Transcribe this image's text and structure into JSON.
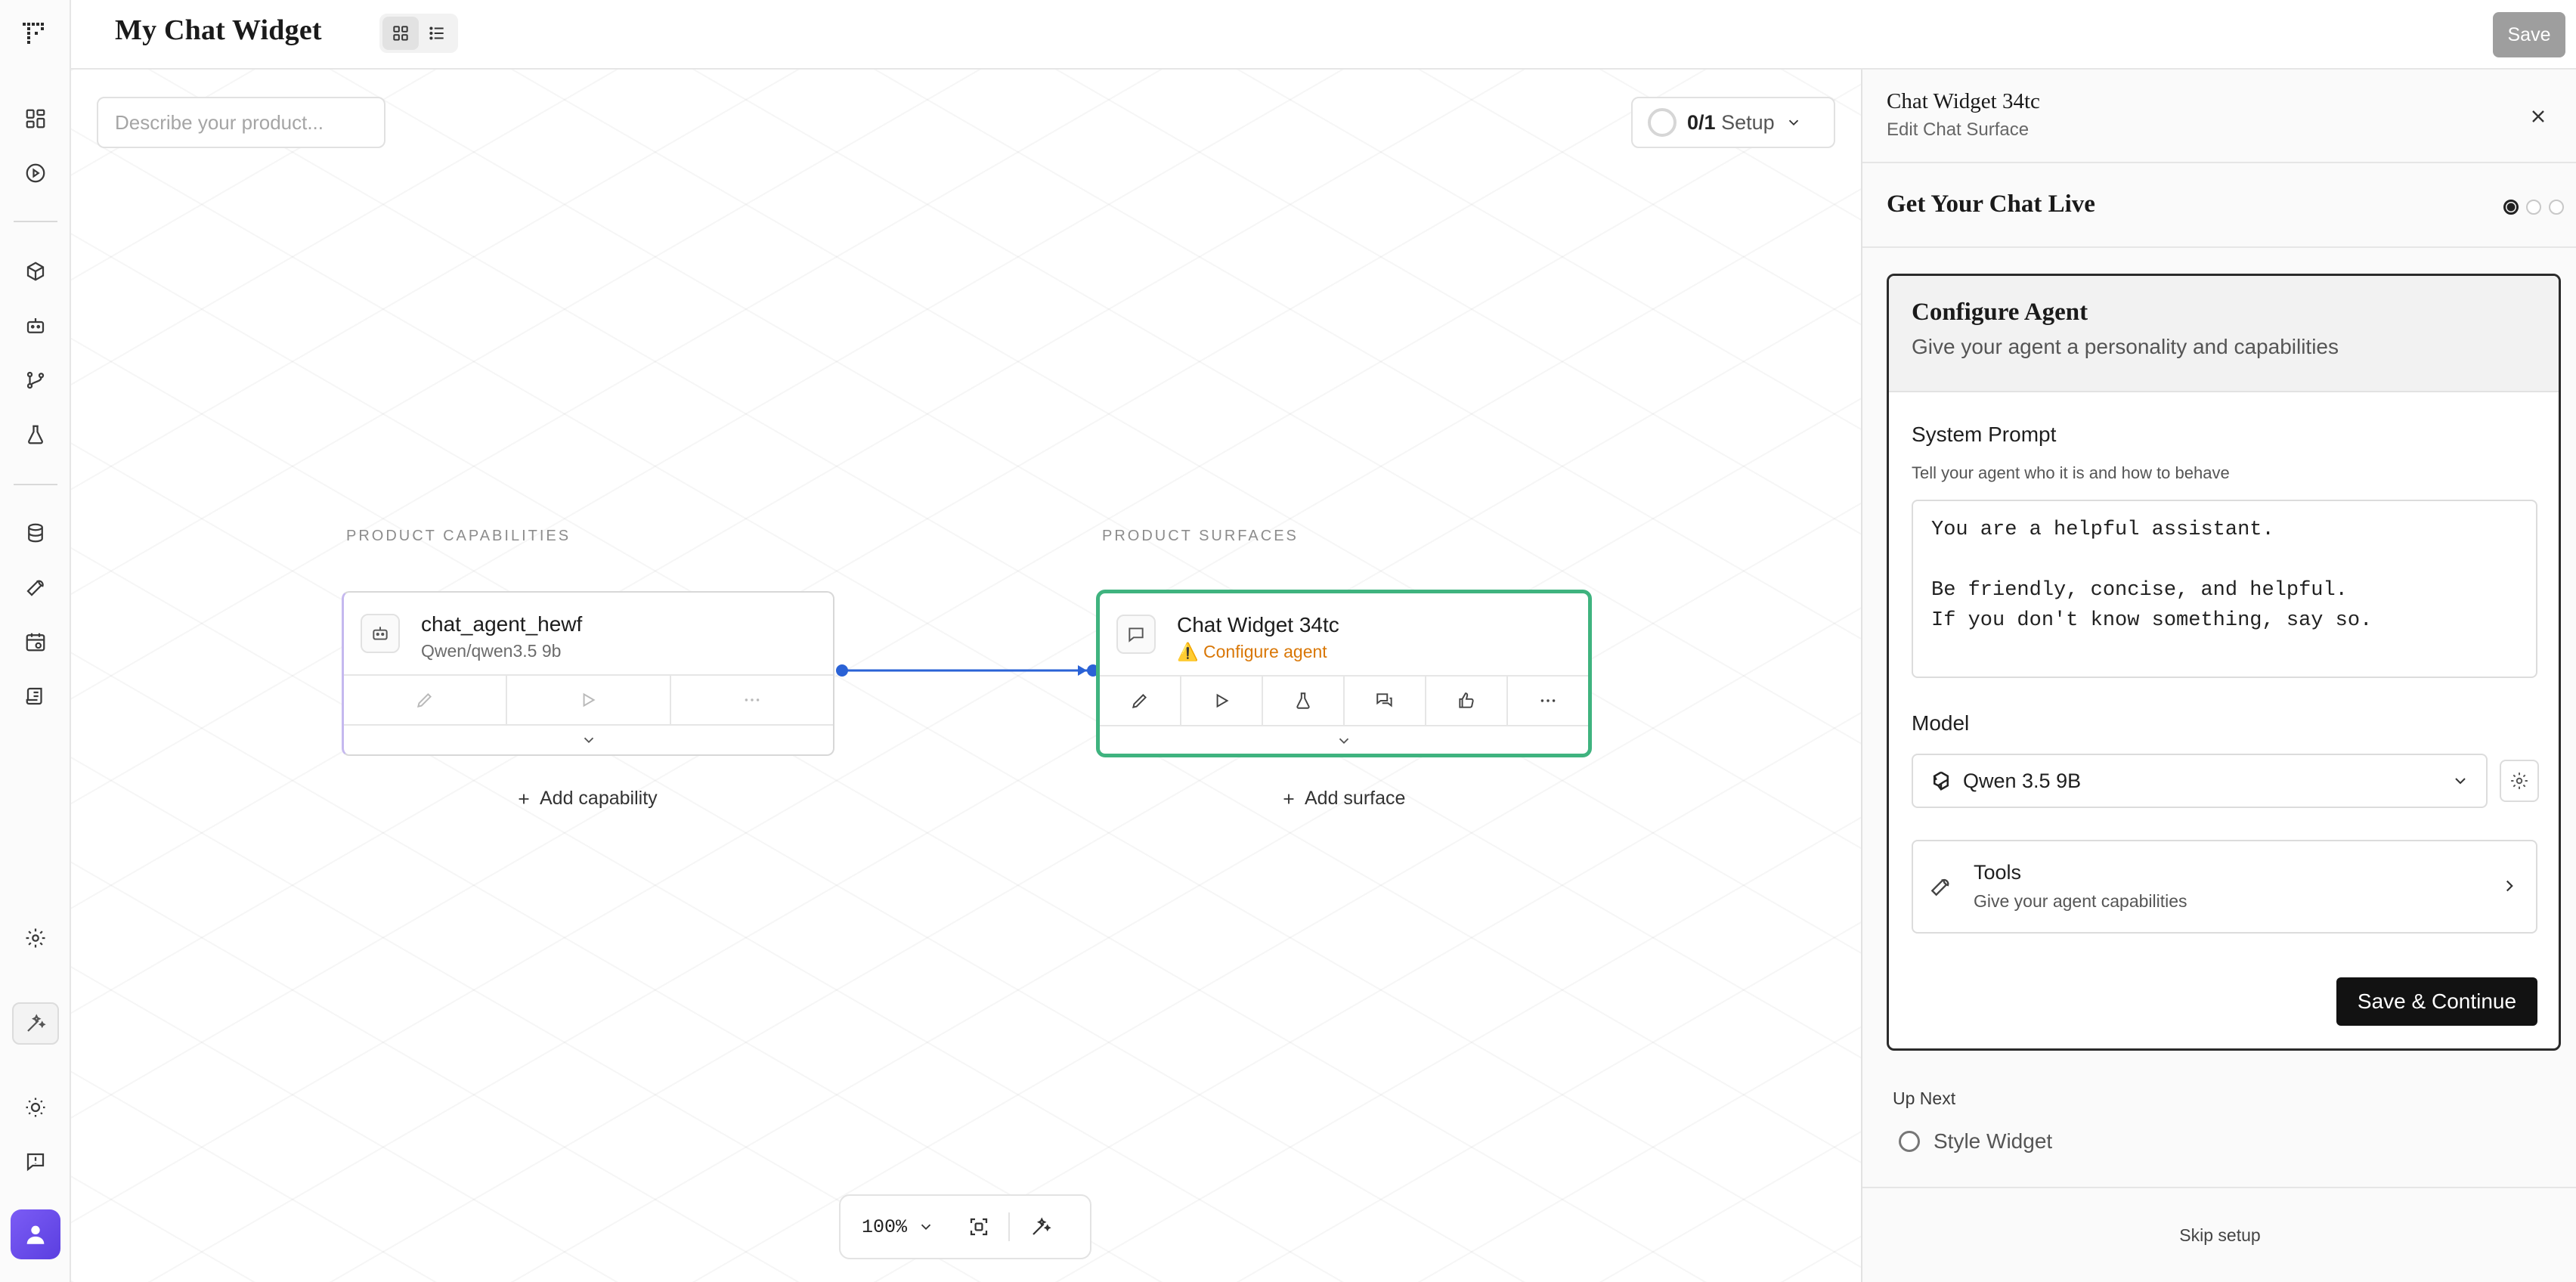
{
  "header": {
    "title": "My Chat Widget",
    "view_toggle": {
      "selected": "grid",
      "options": [
        "grid-icon",
        "list-icon"
      ]
    },
    "save_label": "Save"
  },
  "rail": {
    "top_icons": [
      "dashboard-icon",
      "play-icon"
    ],
    "mid_icons": [
      "cube-icon",
      "bot-icon",
      "branch-icon",
      "flask-icon"
    ],
    "data_icons": [
      "database-icon",
      "wrench-icon",
      "calendar-icon",
      "scroll-icon"
    ],
    "bottom_icons": [
      "settings-icon",
      "magic-icon",
      "sun-icon",
      "feedback-icon"
    ]
  },
  "canvas": {
    "describe_placeholder": "Describe your product...",
    "setup": {
      "fraction": "0/1",
      "label": "Setup"
    },
    "capabilities": {
      "section_label": "PRODUCT CAPABILITIES",
      "node": {
        "title": "chat_agent_hewf",
        "subtitle": "Qwen/qwen3.5 9b"
      },
      "add_label": "Add capability"
    },
    "surfaces": {
      "section_label": "PRODUCT SURFACES",
      "node": {
        "title": "Chat Widget 34tc",
        "warning": "⚠️ Configure agent"
      },
      "add_label": "Add surface"
    },
    "zoom": {
      "value": "100%"
    }
  },
  "panel": {
    "title": "Chat Widget 34tc",
    "subtitle": "Edit Chat Surface",
    "section_title": "Get Your Chat Live",
    "steps": {
      "current": 1,
      "total": 3
    },
    "card": {
      "title": "Configure Agent",
      "subtitle": "Give your agent a personality and capabilities",
      "system_prompt_label": "System Prompt",
      "system_prompt_hint": "Tell your agent who it is and how to behave",
      "system_prompt_value": "You are a helpful assistant.\n\nBe friendly, concise, and helpful.\nIf you don't know something, say so.",
      "model_label": "Model",
      "model_value": "Qwen 3.5 9B",
      "tools_title": "Tools",
      "tools_subtitle": "Give your agent capabilities",
      "save_continue_label": "Save & Continue"
    },
    "up_next_label": "Up Next",
    "up_next_item": "Style Widget",
    "skip_label": "Skip setup"
  },
  "colors": {
    "surface_border": "#3fb37f",
    "connector": "#2a62d6",
    "warning": "#d97706",
    "primary_button": "#121212",
    "avatar": "#6b4ef0"
  }
}
